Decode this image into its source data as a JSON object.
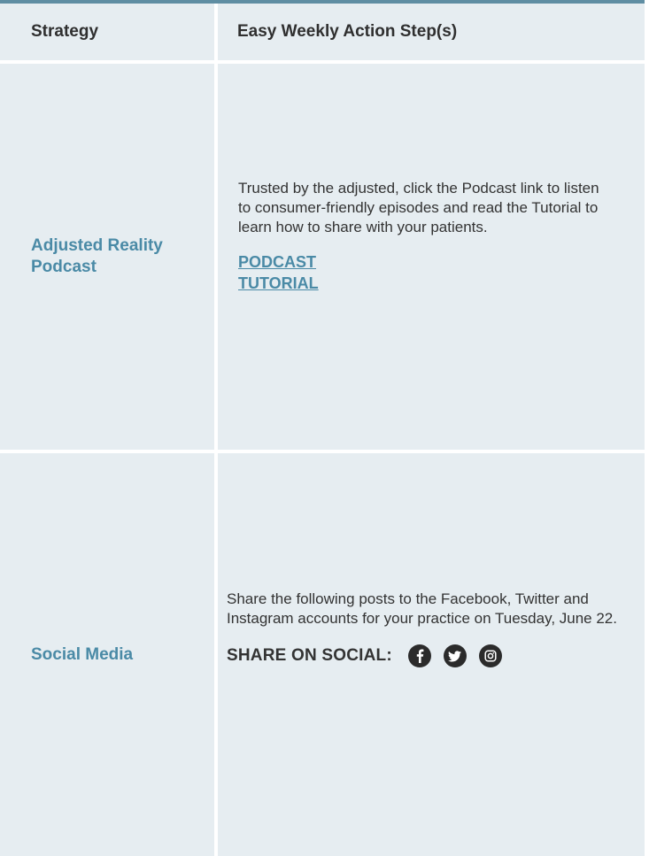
{
  "table": {
    "headers": {
      "strategy": "Strategy",
      "steps": "Easy Weekly Action Step(s)"
    },
    "rows": [
      {
        "strategy": "Adjusted Reality Podcast",
        "text": "Trusted by the adjusted, click the Podcast link to listen to consumer-friendly episodes and read the Tutorial to learn how to share with your patients.",
        "links": [
          "PODCAST",
          "TUTORIAL"
        ]
      },
      {
        "strategy": "Social Media",
        "text": "Share the following posts to the Facebook, Twitter and Instagram accounts for your practice on Tuesday, June 22.",
        "share_label": "SHARE ON SOCIAL:",
        "social_icons": [
          "facebook-icon",
          "twitter-icon",
          "instagram-icon"
        ]
      }
    ]
  },
  "colors": {
    "accent": "#4a8aa6",
    "top_border": "#5f8ea3",
    "cell_bg": "#e6edf1",
    "icon_bg": "#2b2b2b"
  }
}
